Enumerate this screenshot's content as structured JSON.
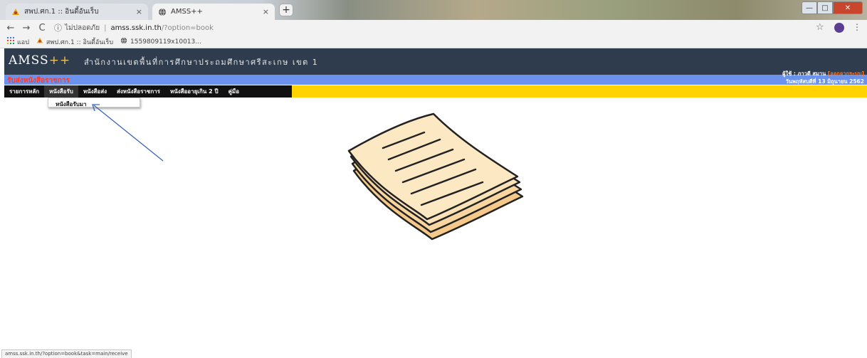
{
  "browser": {
    "tabs": [
      {
        "title": "สพป.ศก.1 :: อินดี้อันเร็บ",
        "active": false
      },
      {
        "title": "AMSS++",
        "active": true
      }
    ],
    "close_glyph": "×",
    "new_tab_glyph": "+",
    "window_controls": {
      "minimize": "—",
      "maximize": "□",
      "close": "✕"
    },
    "nav": {
      "back": "←",
      "forward": "→",
      "reload": "C"
    },
    "omnibox": {
      "info_icon": "ⓘ",
      "security_label": "ไม่ปลอดภัย",
      "host": "amss.ssk.in.th",
      "path": "/?option=book"
    },
    "bookmarks": [
      {
        "icon": "apps-icon",
        "label": "แอป"
      },
      {
        "icon": "site-logo-icon",
        "label": "สพป.ศก.1 :: อินดี้อันเร็บ"
      },
      {
        "icon": "globe-icon",
        "label": "1559809119x10013..."
      }
    ],
    "status_url": "amss.ssk.in.th/?option=book&task=main/receive"
  },
  "page": {
    "brand": "AMSS",
    "brand_suffix": "++",
    "office_name": "สำนักงานเขตพื้นที่การศึกษาประถมศึกษาศรีสะเกษ เขต 1",
    "section_title": "รับส่งหนังสือราชการ",
    "user_prefix": "ผู้ใช้ : ภาวดี สมาน",
    "logout_label": "[ออกจากระบบ]",
    "date": "วันพฤหัสบดีที่ 13 มิถุนายน 2562",
    "menu": [
      "รายการหลัก",
      "หนังสือรับ",
      "หนังสือส่ง",
      "ส่งหนังสือราชการ",
      "หนังสืออายุเกิน 2 ปี",
      "คู่มือ"
    ],
    "active_menu_index": 1,
    "dropdown_item": "หนังสือรับมา"
  },
  "colors": {
    "header_bg": "#2e3c4e",
    "info_bar": "#6b93ee",
    "menu_bar": "#ffd200",
    "section_title": "#ff3b2a",
    "annotation_arrow": "#3b63b7"
  },
  "illustration": "papers-icon"
}
